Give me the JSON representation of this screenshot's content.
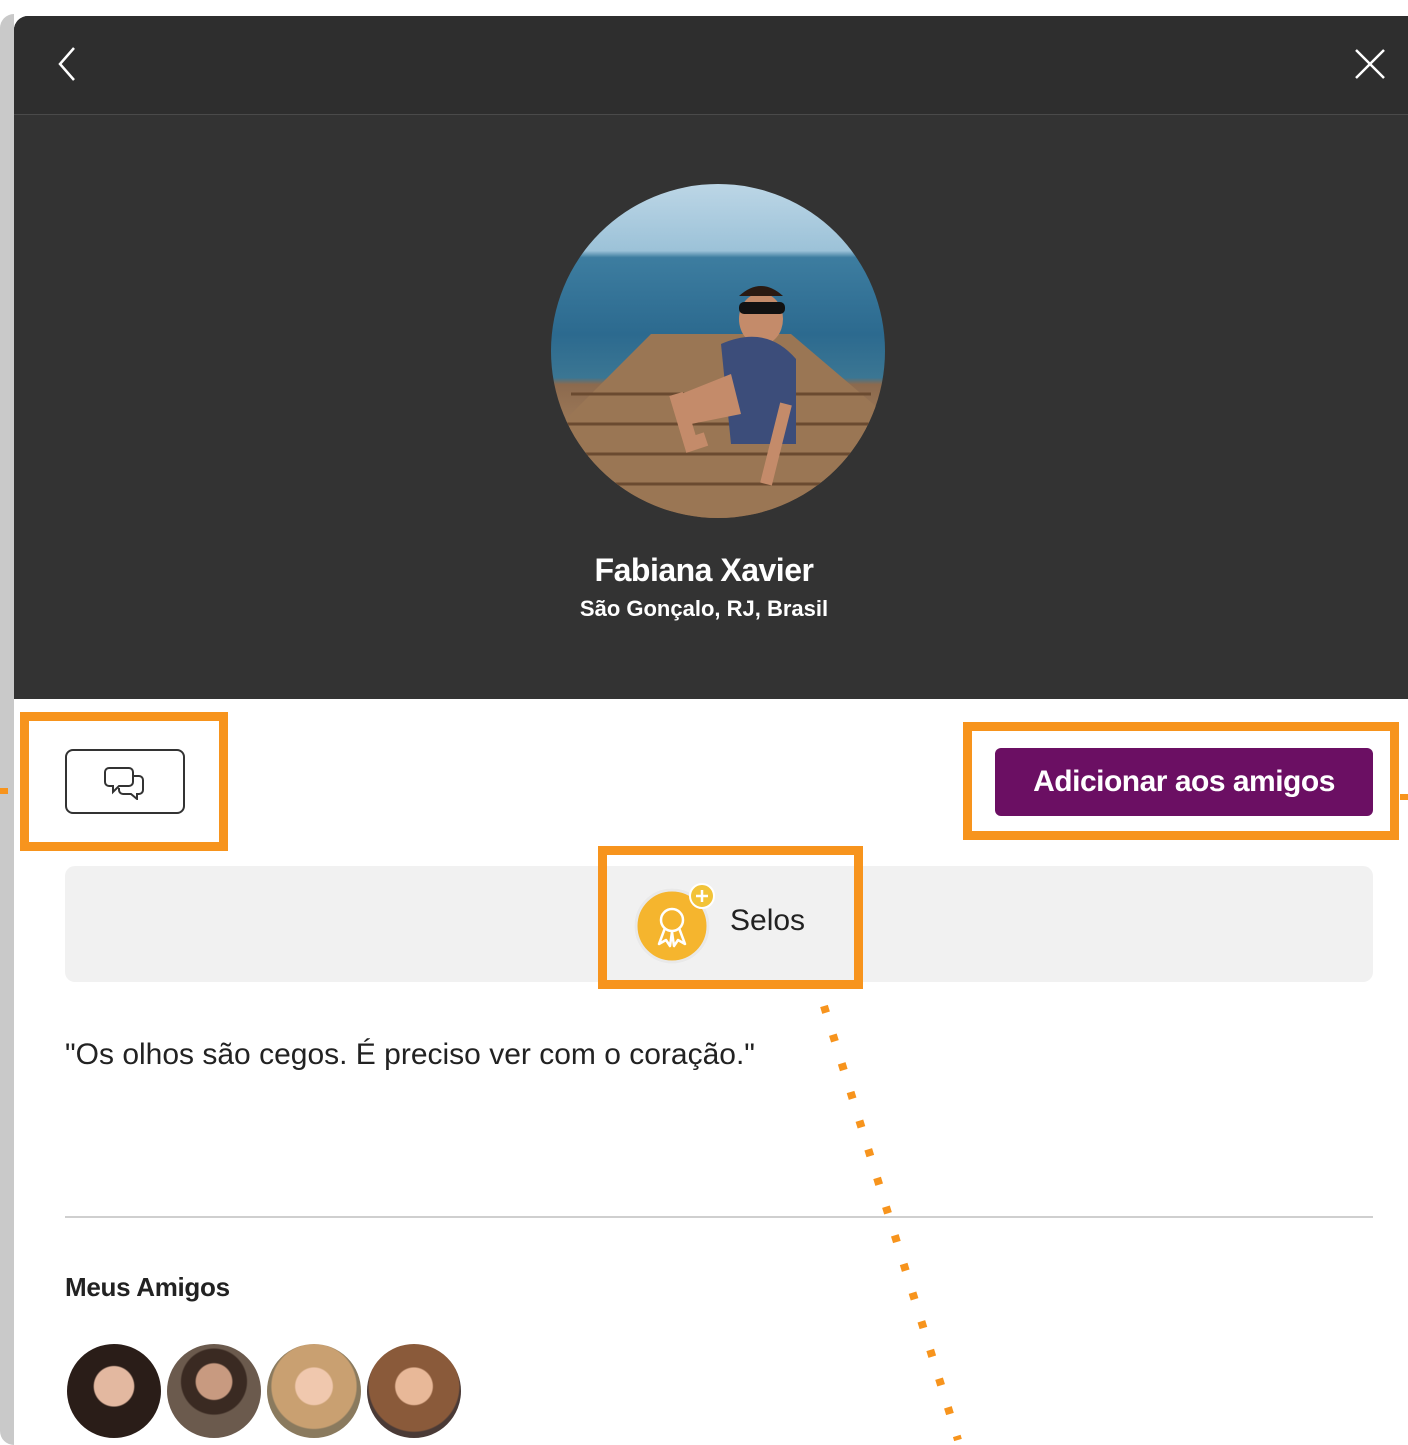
{
  "profile": {
    "name": "Fabiana Xavier",
    "location": "São Gonçalo, RJ, Brasil",
    "quote": "\"Os olhos são cegos. É preciso ver com o coração.\""
  },
  "actions": {
    "add_friend_label": "Adicionar aos amigos"
  },
  "badges": {
    "label": "Selos"
  },
  "friends": {
    "title": "Meus Amigos",
    "count_shown": 4
  },
  "colors": {
    "header_bg": "#333333",
    "accent_purple": "#6b0f63",
    "annotation_orange": "#f7941d",
    "badge_gold": "#f7b733"
  },
  "icons": {
    "back": "chevron-left-icon",
    "close": "close-icon",
    "chat": "chat-bubbles-icon",
    "badge": "award-badge-icon"
  }
}
